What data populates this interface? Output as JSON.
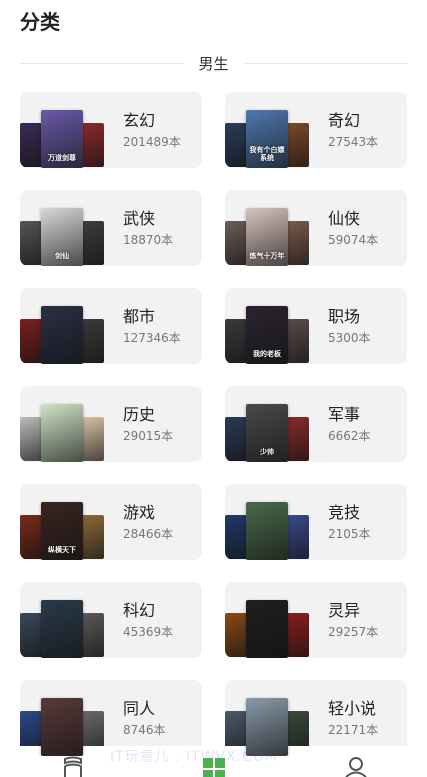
{
  "page": {
    "title": "分类"
  },
  "section": {
    "label": "男生"
  },
  "categories": [
    {
      "name": "玄幻",
      "count": "201489本",
      "cover_caption": "万道剑尊",
      "colors": [
        "#3a2b55",
        "#6a5aa8",
        "#8c2b2b"
      ]
    },
    {
      "name": "奇幻",
      "count": "27543本",
      "cover_caption": "我有个白嫖系统",
      "colors": [
        "#2a3c5c",
        "#4f78b0",
        "#7a4a2a"
      ]
    },
    {
      "name": "武侠",
      "count": "18870本",
      "cover_caption": "剑仙",
      "colors": [
        "#555555",
        "#d8d8d8",
        "#3d3d3d"
      ]
    },
    {
      "name": "仙侠",
      "count": "59074本",
      "cover_caption": "炼气十万年",
      "colors": [
        "#6b5d57",
        "#d7c3bd",
        "#7a5a4a"
      ]
    },
    {
      "name": "都市",
      "count": "127346本",
      "cover_caption": "",
      "colors": [
        "#7a1f1f",
        "#2a2f45",
        "#3a3a3a"
      ]
    },
    {
      "name": "职场",
      "count": "5300本",
      "cover_caption": "我的老板",
      "colors": [
        "#3a3a3a",
        "#2b2430",
        "#5a4b4b"
      ]
    },
    {
      "name": "历史",
      "count": "29015本",
      "cover_caption": "",
      "colors": [
        "#bcbcbc",
        "#cfe3c5",
        "#d8c2a2"
      ]
    },
    {
      "name": "军事",
      "count": "6662本",
      "cover_caption": "少帅",
      "colors": [
        "#2a3a55",
        "#4a4a4a",
        "#8a2a2a"
      ]
    },
    {
      "name": "游戏",
      "count": "28466本",
      "cover_caption": "纵横天下",
      "colors": [
        "#7a2a1a",
        "#3a2520",
        "#8a6a3a"
      ]
    },
    {
      "name": "竞技",
      "count": "2105本",
      "cover_caption": "",
      "colors": [
        "#1f3a6a",
        "#4a6a4a",
        "#3a4a8a"
      ]
    },
    {
      "name": "科幻",
      "count": "45369本",
      "cover_caption": "",
      "colors": [
        "#3a4a5a",
        "#2a3a4a",
        "#5a5a5a"
      ]
    },
    {
      "name": "灵异",
      "count": "29257本",
      "cover_caption": "",
      "colors": [
        "#8a4a1a",
        "#1f1f1f",
        "#8a1f1f"
      ]
    },
    {
      "name": "同人",
      "count": "8746本",
      "cover_caption": "",
      "colors": [
        "#2a4a8a",
        "#5a3a3a",
        "#6a6a6a"
      ]
    },
    {
      "name": "轻小说",
      "count": "22171本",
      "cover_caption": "",
      "colors": [
        "#4a5a6a",
        "#8a9aaa",
        "#3a4a3a"
      ]
    }
  ],
  "tabbar": {
    "watermark": "IT玩意儿 . ITWVX.COM",
    "tabs": [
      {
        "icon": "bookshelf-icon",
        "active": false
      },
      {
        "icon": "category-grid-icon",
        "active": true
      },
      {
        "icon": "profile-icon",
        "active": false
      }
    ],
    "active_color": "#4caf50",
    "inactive_color": "#555555"
  }
}
